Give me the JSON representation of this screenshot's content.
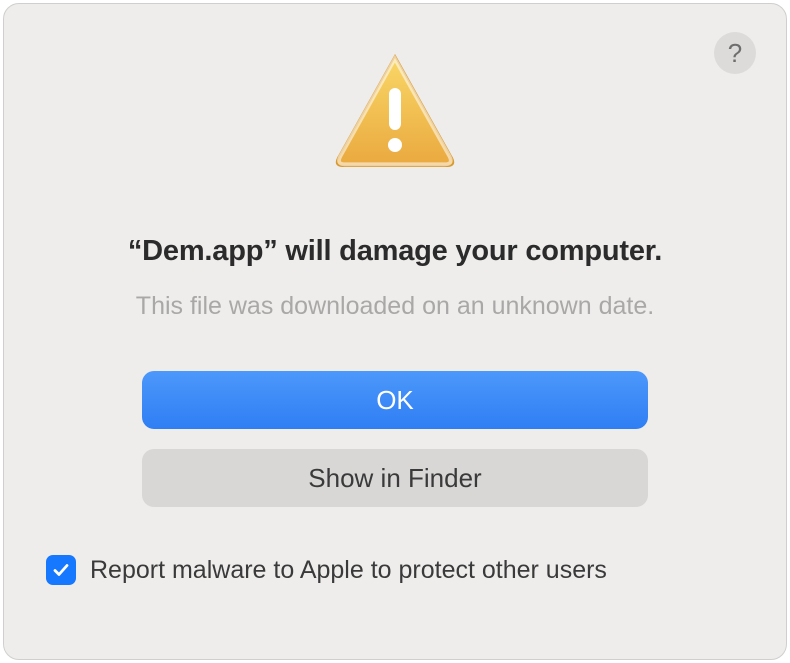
{
  "dialog": {
    "help_icon_label": "?",
    "heading": "“Dem.app” will damage your computer.",
    "subtext": "This file was downloaded on an unknown date.",
    "ok_label": "OK",
    "show_in_finder_label": "Show in Finder",
    "checkbox": {
      "checked": true,
      "label": "Report malware to Apple to protect other users"
    }
  },
  "icons": {
    "warning": "warning-triangle",
    "help": "question-mark",
    "check": "checkmark"
  },
  "colors": {
    "primary_button": "#2f7ef4",
    "secondary_button": "#d8d7d6",
    "checkbox": "#1677ff",
    "background": "#eeedec"
  }
}
